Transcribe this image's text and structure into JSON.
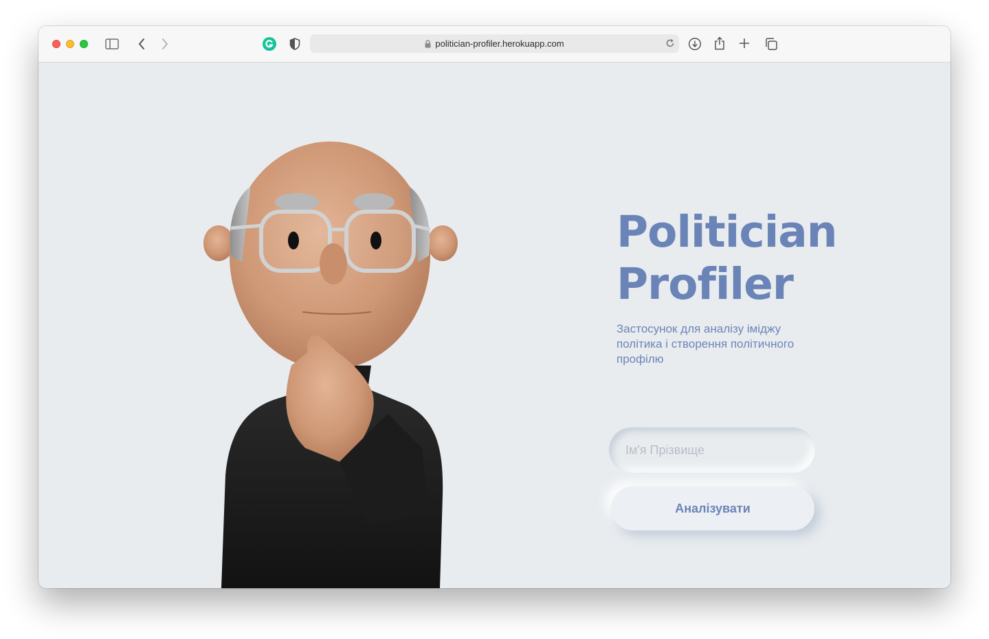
{
  "browser": {
    "url": "politician-profiler.herokuapp.com",
    "icons": [
      "close-light",
      "minimize-light",
      "zoom-light",
      "sidebar-icon",
      "back-icon",
      "forward-icon",
      "grammarly-icon",
      "shield-icon",
      "lock-icon",
      "reload-icon",
      "download-icon",
      "share-icon",
      "new-tab-icon",
      "tabs-overview-icon"
    ]
  },
  "hero": {
    "title_line1": "Politician",
    "title_line2": "Profiler",
    "subtitle": "Застосунок для аналізу іміджу політика і створення політичного профілю"
  },
  "form": {
    "name_placeholder": "Ім'я Прізвище",
    "name_value": "",
    "analyze_label": "Аналізувати"
  },
  "colors": {
    "accent": "#6b84b8",
    "background": "#e8ecef"
  }
}
